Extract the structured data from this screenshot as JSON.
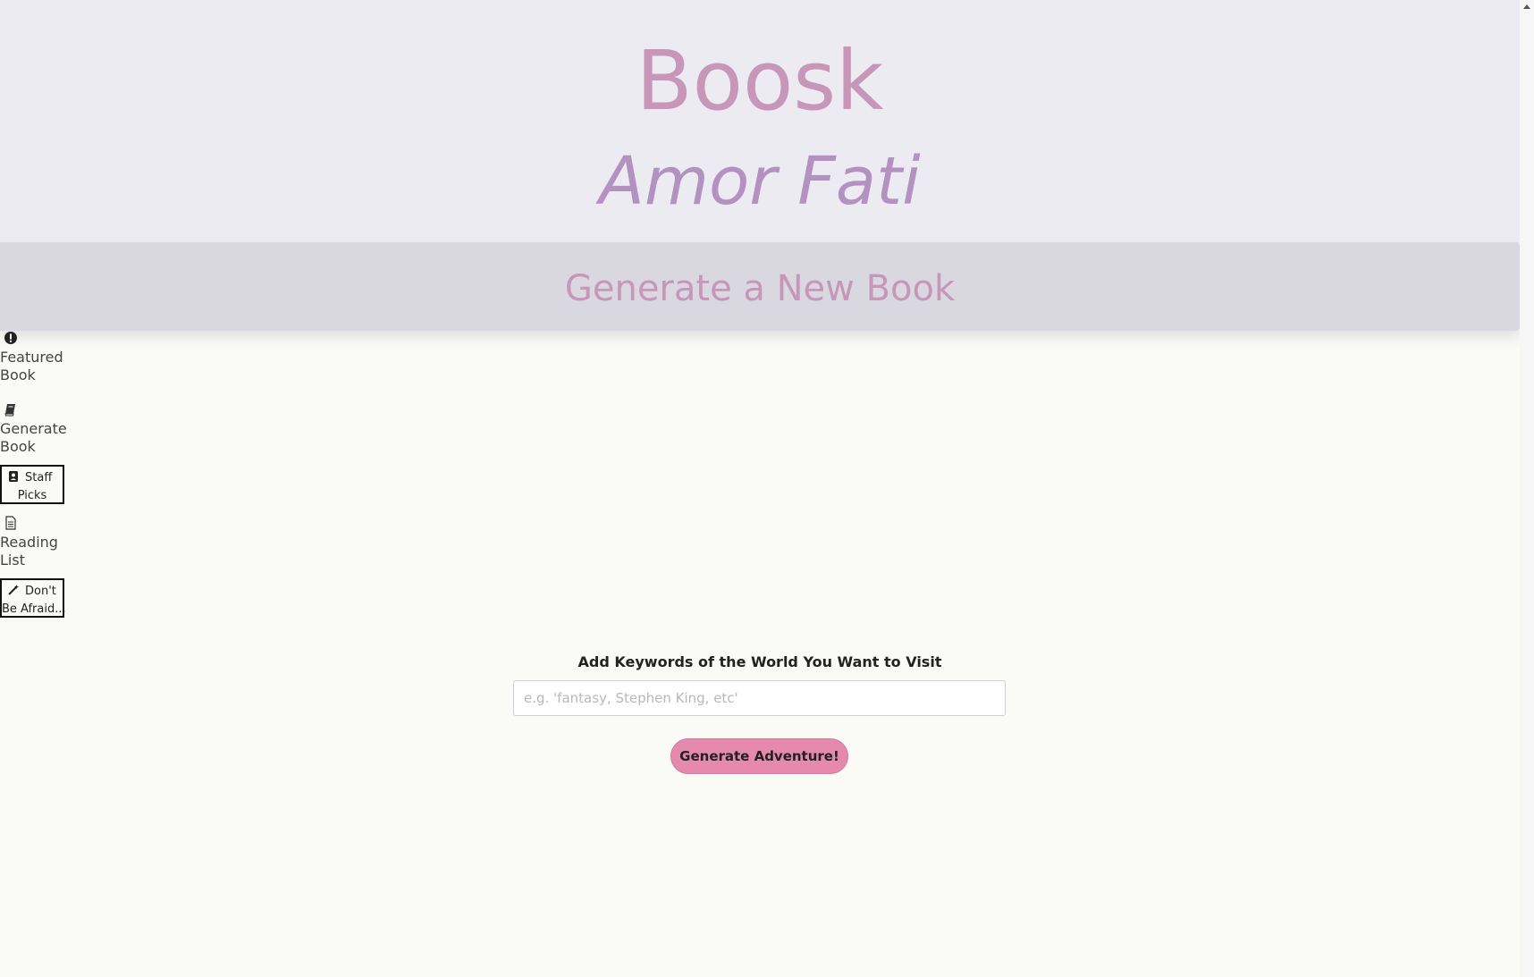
{
  "header": {
    "brand": "Boosk",
    "tagline": "Amor Fati"
  },
  "banner": {
    "title": "Generate a New Book"
  },
  "nav": {
    "items": [
      {
        "label_line1": "Featured",
        "label_line2": "Book",
        "icon": "exclamation-circle-icon"
      },
      {
        "label_line1": "Generate",
        "label_line2": "Book",
        "icon": "book-icon"
      },
      {
        "label_line1": "Staff",
        "label_line2": "Picks",
        "icon": "user-badge-icon"
      },
      {
        "label_line1": "Reading",
        "label_line2": "List",
        "icon": "document-icon"
      },
      {
        "label_line1": "Don't",
        "label_line2": "Be Afraid...",
        "icon": "magic-wand-icon"
      }
    ]
  },
  "form": {
    "label": "Add Keywords of the World You Want to Visit",
    "input_value": "",
    "input_placeholder": "e.g. 'fantasy, Stephen King, etc'",
    "button_label": "Generate Adventure!"
  },
  "colors": {
    "brand": "#c796b9",
    "tagline": "#b392c2",
    "header_bg": "#ecebf1",
    "banner_bg": "#d9d8e1",
    "button_bg": "#e58aad",
    "page_bg": "#fafaf7"
  }
}
